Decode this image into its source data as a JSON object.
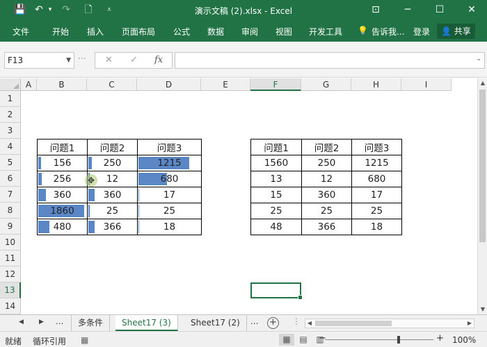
{
  "titlebar": {
    "title": "演示文稿 (2).xlsx - Excel",
    "save_icon": "💾",
    "undo_icon": "↶",
    "redo_icon": "↷",
    "new_icon": "🗋",
    "customize_icon": "⩡",
    "ribbon_display_icon": "⊡",
    "minimize_icon": "─",
    "maximize_icon": "☐",
    "close_icon": "✕"
  },
  "ribbon": {
    "tabs": [
      "文件",
      "开始",
      "插入",
      "页面布局",
      "公式",
      "数据",
      "审阅",
      "视图",
      "开发工具"
    ],
    "tell_me": "告诉我...",
    "tell_me_icon": "💡",
    "login": "登录",
    "share": "共享",
    "share_icon": "👤"
  },
  "formula_bar": {
    "name_box": "F13",
    "name_box_dropdown": "▼",
    "cancel_icon": "✕",
    "confirm_icon": "✓",
    "function_icon": "fx",
    "formula": "",
    "expand_icon": "⌄"
  },
  "grid": {
    "columns": [
      "A",
      "B",
      "C",
      "D",
      "E",
      "F",
      "G",
      "H",
      "I"
    ],
    "selected_column": "F",
    "rows": [
      "1",
      "2",
      "3",
      "4",
      "5",
      "6",
      "7",
      "8",
      "9",
      "10",
      "11",
      "12",
      "13",
      "14"
    ],
    "selected_row": "13",
    "active_cell": "F13"
  },
  "table_left": {
    "headers": [
      "问题1",
      "问题2",
      "问题3"
    ],
    "rows": [
      [
        {
          "v": "156",
          "bar": 0.08
        },
        {
          "v": "250",
          "bar": 0.1
        },
        {
          "v": "1215",
          "bar": 0.82
        }
      ],
      [
        {
          "v": "256",
          "bar": 0.1
        },
        {
          "v": "12",
          "bar": 0.05
        },
        {
          "v": "680",
          "bar": 0.47
        }
      ],
      [
        {
          "v": "360",
          "bar": 0.18
        },
        {
          "v": "360",
          "bar": 0.15
        },
        {
          "v": "17",
          "bar": 0.03
        }
      ],
      [
        {
          "v": "1860",
          "bar": 0.96
        },
        {
          "v": "25",
          "bar": 0.06
        },
        {
          "v": "25",
          "bar": 0.03
        }
      ],
      [
        {
          "v": "480",
          "bar": 0.25
        },
        {
          "v": "366",
          "bar": 0.16
        },
        {
          "v": "18",
          "bar": 0.03
        }
      ]
    ]
  },
  "table_right": {
    "headers": [
      "问题1",
      "问题2",
      "问题3"
    ],
    "rows": [
      [
        "1560",
        "250",
        "1215"
      ],
      [
        "13",
        "12",
        "680"
      ],
      [
        "15",
        "360",
        "17"
      ],
      [
        "25",
        "25",
        "25"
      ],
      [
        "48",
        "366",
        "18"
      ]
    ]
  },
  "sheet_tabs": {
    "prev_icon": "◀",
    "next_icon": "▶",
    "more": "...",
    "tabs": [
      "多条件",
      "Sheet17 (3)",
      "Sheet17 (2)"
    ],
    "active": "Sheet17 (3)",
    "more_right": "...",
    "add_icon": "+"
  },
  "status_bar": {
    "ready": "就绪",
    "circular": "循环引用",
    "macro_icon": "▦",
    "normal_view_icon": "▦",
    "page_layout_icon": "▤",
    "page_break_icon": "▥",
    "zoom_out": "−",
    "zoom_in": "+",
    "zoom_level": "100%"
  },
  "colors": {
    "accent": "#217346",
    "data_bar": "#5b87c7"
  }
}
